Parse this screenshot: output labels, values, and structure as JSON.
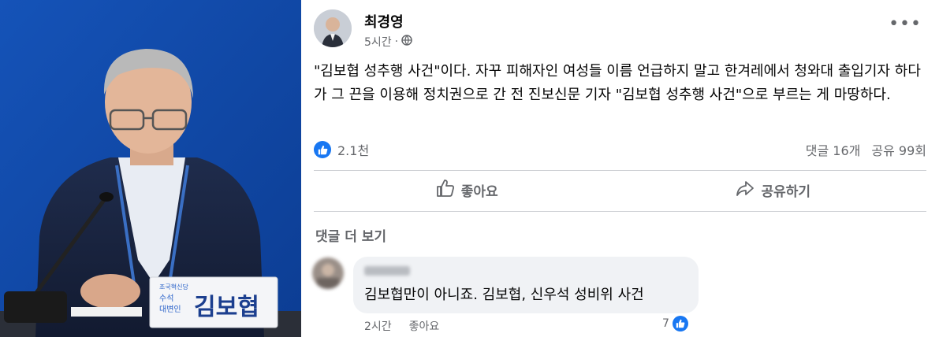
{
  "photo": {
    "nameplate_small": "조국혁신당",
    "nameplate_role": "수석\n대변인",
    "nameplate_name": "김보협"
  },
  "post": {
    "author": "최경영",
    "time": "5시간",
    "separator": "·",
    "body": "\"김보협 성추행 사건\"이다. 자꾸 피해자인 여성들 이름 언급하지 말고 한겨레에서 청와대 출입기자 하다가 그 끈을 이용해 정치권으로 간 전 진보신문 기자 \"김보협 성추행 사건\"으로 부르는 게 마땅하다.",
    "reactions": "2.1천",
    "comments_count": "댓글 16개",
    "shares_count": "공유 99회",
    "like_label": "좋아요",
    "share_label": "공유하기",
    "more_comments": "댓글 더 보기"
  },
  "comment": {
    "text": "김보협만이 아니죠. 김보협, 신우석 성비위 사건",
    "time": "2시간",
    "like_label": "좋아요",
    "likes": "7"
  },
  "colors": {
    "accent": "#1877f2",
    "secondary_text": "#65676b"
  }
}
